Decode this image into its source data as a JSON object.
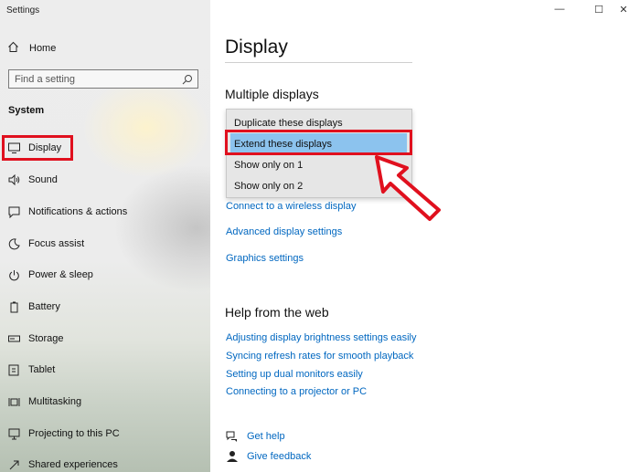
{
  "window": {
    "title": "Settings",
    "controls": {
      "minimize": "—",
      "maximize": "☐",
      "close": "✕"
    }
  },
  "sidebar": {
    "home": {
      "label": "Home",
      "icon": "home-icon"
    },
    "search": {
      "placeholder": "Find a setting",
      "icon": "search-icon"
    },
    "section": "System",
    "items": [
      {
        "label": "Display",
        "icon": "monitor-icon"
      },
      {
        "label": "Sound",
        "icon": "speaker-icon"
      },
      {
        "label": "Notifications & actions",
        "icon": "notification-icon"
      },
      {
        "label": "Focus assist",
        "icon": "moon-icon"
      },
      {
        "label": "Power & sleep",
        "icon": "power-icon"
      },
      {
        "label": "Battery",
        "icon": "battery-icon"
      },
      {
        "label": "Storage",
        "icon": "storage-icon"
      },
      {
        "label": "Tablet",
        "icon": "tablet-icon"
      },
      {
        "label": "Multitasking",
        "icon": "multitasking-icon"
      },
      {
        "label": "Projecting to this PC",
        "icon": "projector-icon"
      },
      {
        "label": "Shared experiences",
        "icon": "shared-icon"
      }
    ],
    "highlight_color": "#e0101e"
  },
  "main": {
    "title": "Display",
    "multiple_displays": {
      "heading": "Multiple displays",
      "options": [
        "Duplicate these displays",
        "Extend these displays",
        "Show only on 1",
        "Show only on 2"
      ],
      "selected": "Extend these displays"
    },
    "links": [
      "Connect to a wireless display",
      "Advanced display settings",
      "Graphics settings"
    ],
    "help": {
      "heading": "Help from the web",
      "links": [
        "Adjusting display brightness settings easily",
        "Syncing refresh rates for smooth playback",
        "Setting up dual monitors easily",
        "Connecting to a projector or PC"
      ]
    },
    "footer": {
      "get_help": "Get help",
      "give_feedback": "Give feedback"
    },
    "accent_color": "#0067c0",
    "selection_color": "#8cc3ee"
  }
}
